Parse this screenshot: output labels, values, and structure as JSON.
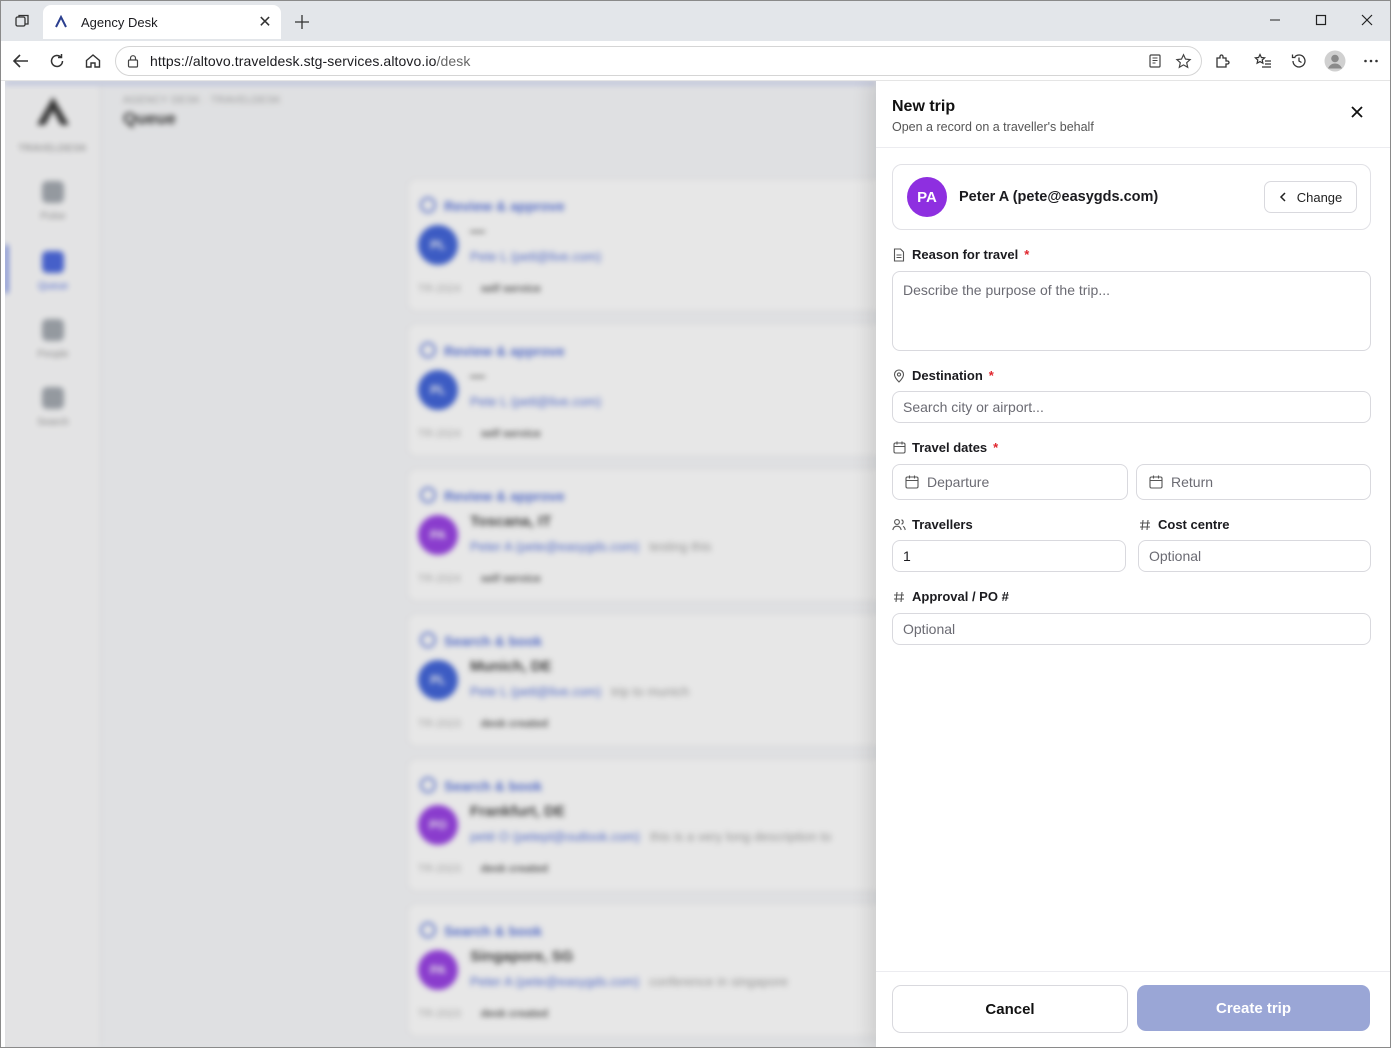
{
  "browser": {
    "tab_title": "Agency Desk",
    "url_host": "https://altovo.traveldesk.stg-services.altovo.io",
    "url_path": "/desk"
  },
  "app": {
    "brand": "TRAVELDESK",
    "breadcrumb": "AGENCY DESK · TRAVELDESK",
    "page_title": "Queue",
    "nav": [
      {
        "label": "Pulse"
      },
      {
        "label": "Queue"
      },
      {
        "label": "People"
      },
      {
        "label": "Search"
      }
    ],
    "queue": [
      {
        "type": "Review & approve",
        "initials": "PL",
        "avatar_color": "#2f55d4",
        "destination": "—",
        "email": "Pete L (petl@live.com)",
        "note": "",
        "date": "TR-2024",
        "channel": "self service"
      },
      {
        "type": "Review & approve",
        "initials": "PL",
        "avatar_color": "#2f55d4",
        "destination": "—",
        "email": "Pete L (petl@live.com)",
        "note": "",
        "date": "TR-2024",
        "channel": "self service"
      },
      {
        "type": "Review & approve",
        "initials": "PA",
        "avatar_color": "#8e2fe0",
        "destination": "Toscana, IT",
        "email": "Peter A (pete@easygds.com)",
        "note": "testing this",
        "date": "TR-2024",
        "channel": "self service"
      },
      {
        "type": "Search & book",
        "initials": "PL",
        "avatar_color": "#2f55d4",
        "destination": "Munich, DE",
        "email": "Pete L (petl@live.com)",
        "note": "trip to munich",
        "date": "TR-2023",
        "channel": "desk created"
      },
      {
        "type": "Search & book",
        "initials": "PO",
        "avatar_color": "#8e2fe0",
        "destination": "Frankfurt, DE",
        "email": "peté O (petepl@outlook.com)",
        "note": "this is a very long description to",
        "date": "TR-2023",
        "channel": "desk created"
      },
      {
        "type": "Search & book",
        "initials": "PA",
        "avatar_color": "#8e2fe0",
        "destination": "Singapore, SG",
        "email": "Peter A (pete@easygds.com)",
        "note": "conference in singapore",
        "date": "TR-2023",
        "channel": "desk created"
      }
    ]
  },
  "drawer": {
    "title": "New trip",
    "subtitle": "Open a record on a traveller's behalf",
    "traveller": {
      "initials": "PA",
      "name": "Peter A (pete@easygds.com)"
    },
    "change_label": "Change",
    "reason": {
      "label": "Reason for travel",
      "placeholder": "Describe the purpose of the trip...",
      "required": "*"
    },
    "destination": {
      "label": "Destination",
      "placeholder": "Search city or airport...",
      "required": "*"
    },
    "dates": {
      "label": "Travel dates",
      "required": "*",
      "departure": "Departure",
      "return": "Return"
    },
    "travellers": {
      "label": "Travellers",
      "value": "1"
    },
    "cost_centre": {
      "label": "Cost centre",
      "placeholder": "Optional"
    },
    "approval": {
      "label": "Approval / PO #",
      "placeholder": "Optional"
    },
    "cancel_label": "Cancel",
    "create_label": "Create trip"
  }
}
